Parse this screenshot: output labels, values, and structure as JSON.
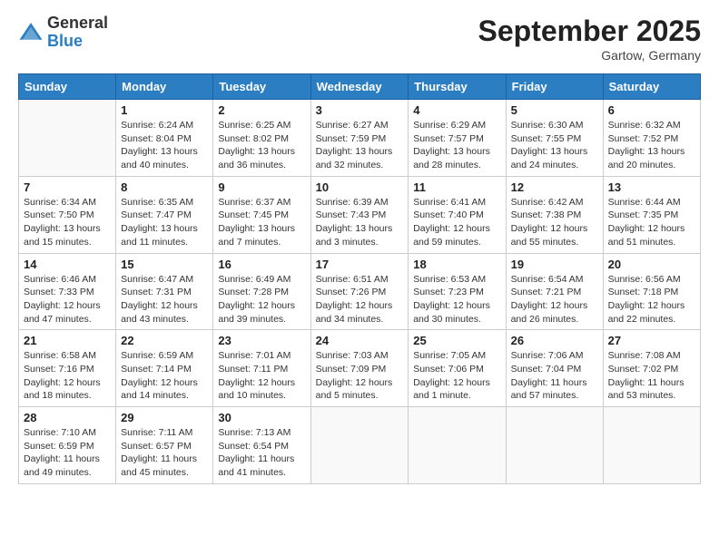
{
  "logo": {
    "general": "General",
    "blue": "Blue"
  },
  "header": {
    "month": "September 2025",
    "location": "Gartow, Germany"
  },
  "weekdays": [
    "Sunday",
    "Monday",
    "Tuesday",
    "Wednesday",
    "Thursday",
    "Friday",
    "Saturday"
  ],
  "weeks": [
    [
      {
        "day": "",
        "content": ""
      },
      {
        "day": "1",
        "content": "Sunrise: 6:24 AM\nSunset: 8:04 PM\nDaylight: 13 hours\nand 40 minutes."
      },
      {
        "day": "2",
        "content": "Sunrise: 6:25 AM\nSunset: 8:02 PM\nDaylight: 13 hours\nand 36 minutes."
      },
      {
        "day": "3",
        "content": "Sunrise: 6:27 AM\nSunset: 7:59 PM\nDaylight: 13 hours\nand 32 minutes."
      },
      {
        "day": "4",
        "content": "Sunrise: 6:29 AM\nSunset: 7:57 PM\nDaylight: 13 hours\nand 28 minutes."
      },
      {
        "day": "5",
        "content": "Sunrise: 6:30 AM\nSunset: 7:55 PM\nDaylight: 13 hours\nand 24 minutes."
      },
      {
        "day": "6",
        "content": "Sunrise: 6:32 AM\nSunset: 7:52 PM\nDaylight: 13 hours\nand 20 minutes."
      }
    ],
    [
      {
        "day": "7",
        "content": "Sunrise: 6:34 AM\nSunset: 7:50 PM\nDaylight: 13 hours\nand 15 minutes."
      },
      {
        "day": "8",
        "content": "Sunrise: 6:35 AM\nSunset: 7:47 PM\nDaylight: 13 hours\nand 11 minutes."
      },
      {
        "day": "9",
        "content": "Sunrise: 6:37 AM\nSunset: 7:45 PM\nDaylight: 13 hours\nand 7 minutes."
      },
      {
        "day": "10",
        "content": "Sunrise: 6:39 AM\nSunset: 7:43 PM\nDaylight: 13 hours\nand 3 minutes."
      },
      {
        "day": "11",
        "content": "Sunrise: 6:41 AM\nSunset: 7:40 PM\nDaylight: 12 hours\nand 59 minutes."
      },
      {
        "day": "12",
        "content": "Sunrise: 6:42 AM\nSunset: 7:38 PM\nDaylight: 12 hours\nand 55 minutes."
      },
      {
        "day": "13",
        "content": "Sunrise: 6:44 AM\nSunset: 7:35 PM\nDaylight: 12 hours\nand 51 minutes."
      }
    ],
    [
      {
        "day": "14",
        "content": "Sunrise: 6:46 AM\nSunset: 7:33 PM\nDaylight: 12 hours\nand 47 minutes."
      },
      {
        "day": "15",
        "content": "Sunrise: 6:47 AM\nSunset: 7:31 PM\nDaylight: 12 hours\nand 43 minutes."
      },
      {
        "day": "16",
        "content": "Sunrise: 6:49 AM\nSunset: 7:28 PM\nDaylight: 12 hours\nand 39 minutes."
      },
      {
        "day": "17",
        "content": "Sunrise: 6:51 AM\nSunset: 7:26 PM\nDaylight: 12 hours\nand 34 minutes."
      },
      {
        "day": "18",
        "content": "Sunrise: 6:53 AM\nSunset: 7:23 PM\nDaylight: 12 hours\nand 30 minutes."
      },
      {
        "day": "19",
        "content": "Sunrise: 6:54 AM\nSunset: 7:21 PM\nDaylight: 12 hours\nand 26 minutes."
      },
      {
        "day": "20",
        "content": "Sunrise: 6:56 AM\nSunset: 7:18 PM\nDaylight: 12 hours\nand 22 minutes."
      }
    ],
    [
      {
        "day": "21",
        "content": "Sunrise: 6:58 AM\nSunset: 7:16 PM\nDaylight: 12 hours\nand 18 minutes."
      },
      {
        "day": "22",
        "content": "Sunrise: 6:59 AM\nSunset: 7:14 PM\nDaylight: 12 hours\nand 14 minutes."
      },
      {
        "day": "23",
        "content": "Sunrise: 7:01 AM\nSunset: 7:11 PM\nDaylight: 12 hours\nand 10 minutes."
      },
      {
        "day": "24",
        "content": "Sunrise: 7:03 AM\nSunset: 7:09 PM\nDaylight: 12 hours\nand 5 minutes."
      },
      {
        "day": "25",
        "content": "Sunrise: 7:05 AM\nSunset: 7:06 PM\nDaylight: 12 hours\nand 1 minute."
      },
      {
        "day": "26",
        "content": "Sunrise: 7:06 AM\nSunset: 7:04 PM\nDaylight: 11 hours\nand 57 minutes."
      },
      {
        "day": "27",
        "content": "Sunrise: 7:08 AM\nSunset: 7:02 PM\nDaylight: 11 hours\nand 53 minutes."
      }
    ],
    [
      {
        "day": "28",
        "content": "Sunrise: 7:10 AM\nSunset: 6:59 PM\nDaylight: 11 hours\nand 49 minutes."
      },
      {
        "day": "29",
        "content": "Sunrise: 7:11 AM\nSunset: 6:57 PM\nDaylight: 11 hours\nand 45 minutes."
      },
      {
        "day": "30",
        "content": "Sunrise: 7:13 AM\nSunset: 6:54 PM\nDaylight: 11 hours\nand 41 minutes."
      },
      {
        "day": "",
        "content": ""
      },
      {
        "day": "",
        "content": ""
      },
      {
        "day": "",
        "content": ""
      },
      {
        "day": "",
        "content": ""
      }
    ]
  ]
}
